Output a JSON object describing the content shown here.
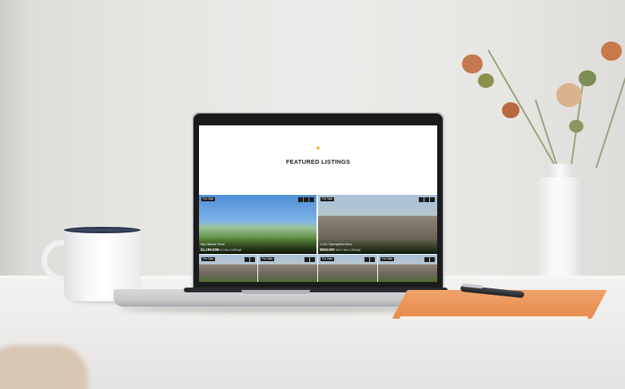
{
  "scene": {
    "description_icons": [
      "coffee-mug-icon",
      "laptop-icon",
      "vase-icon",
      "notebook-icon",
      "pen-icon"
    ]
  },
  "screen": {
    "bulb_icon": "lightbulb-icon",
    "heading": "FEATURED LISTINGS",
    "listings": [
      {
        "badge": "For Sale",
        "address": "Big Hillside Drive",
        "price": "$1,199,000",
        "specs": "4bd  3.5ba  3,450sqft",
        "kind": "sky"
      },
      {
        "badge": "For Sale",
        "address": "1,221 Springfield Drive",
        "price": "$849,900",
        "specs": "4bd  2.5ba  2,450sqft",
        "kind": "house"
      },
      {
        "badge": "For Sale",
        "kind": "house"
      },
      {
        "badge": "For Sale",
        "kind": "house"
      },
      {
        "badge": "For Sale",
        "kind": "house"
      },
      {
        "badge": "For Sale",
        "kind": "house"
      }
    ]
  },
  "colors": {
    "notebook": "#e78b4e",
    "mug_rim": "#253046",
    "bulb": "#f0c34a"
  }
}
